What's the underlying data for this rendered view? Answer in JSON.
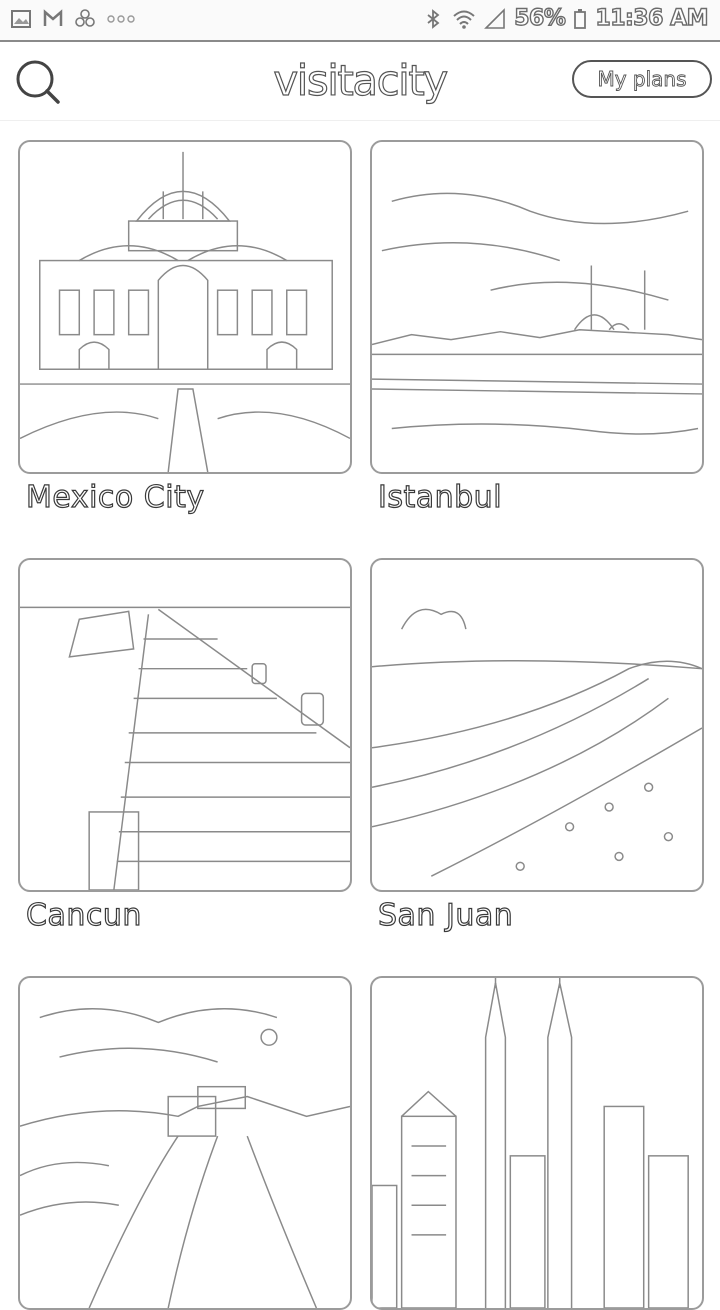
{
  "status_bar": {
    "battery": "56%",
    "time": "11:36 AM",
    "icons": [
      "gallery-icon",
      "gmail-icon",
      "flower-icon",
      "more-dots-icon",
      "bluetooth-icon",
      "wifi-icon",
      "signal-icon",
      "battery-icon"
    ]
  },
  "header": {
    "logo": "visitacity",
    "my_plans_label": "My plans",
    "search_icon": "search-icon"
  },
  "cities": [
    {
      "name": "Mexico City",
      "image": "palace-dome-image"
    },
    {
      "name": "Istanbul",
      "image": "skyline-mosque-image"
    },
    {
      "name": "Cancun",
      "image": "pier-image"
    },
    {
      "name": "San Juan",
      "image": "beach-image"
    },
    {
      "name": "",
      "image": "great-wall-image"
    },
    {
      "name": "",
      "image": "twin-towers-image"
    }
  ]
}
